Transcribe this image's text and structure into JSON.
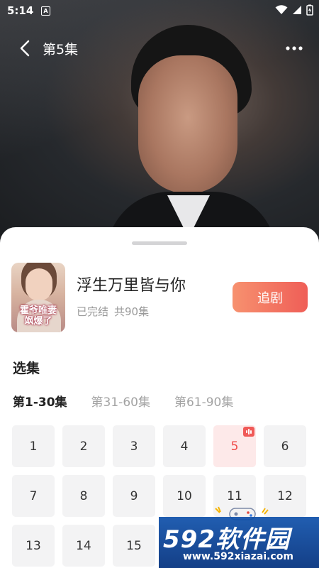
{
  "status_bar": {
    "time": "5:14",
    "app_badge": "A"
  },
  "nav": {
    "title": "第5集"
  },
  "drama": {
    "title": "浮生万里皆与你",
    "status": "已完结",
    "count": "共90集",
    "cover_text": "霍爷唯妻 飒爆了",
    "follow_label": "追剧"
  },
  "section_title": "选集",
  "range_tabs": [
    {
      "label": "第1-30集",
      "active": true
    },
    {
      "label": "第31-60集",
      "active": false
    },
    {
      "label": "第61-90集",
      "active": false
    }
  ],
  "episodes": [
    "1",
    "2",
    "3",
    "4",
    "5",
    "6",
    "7",
    "8",
    "9",
    "10",
    "11",
    "12",
    "13",
    "14",
    "15"
  ],
  "current_episode": "5",
  "watermark": {
    "big": "592软件园",
    "url": "www.592xiazai.com"
  },
  "colors": {
    "accent": "#ef4a48",
    "button_start": "#f7916f",
    "button_end": "#ef5e57",
    "tile_bg": "#f3f3f4",
    "current_tile_bg": "#fde9e9"
  }
}
